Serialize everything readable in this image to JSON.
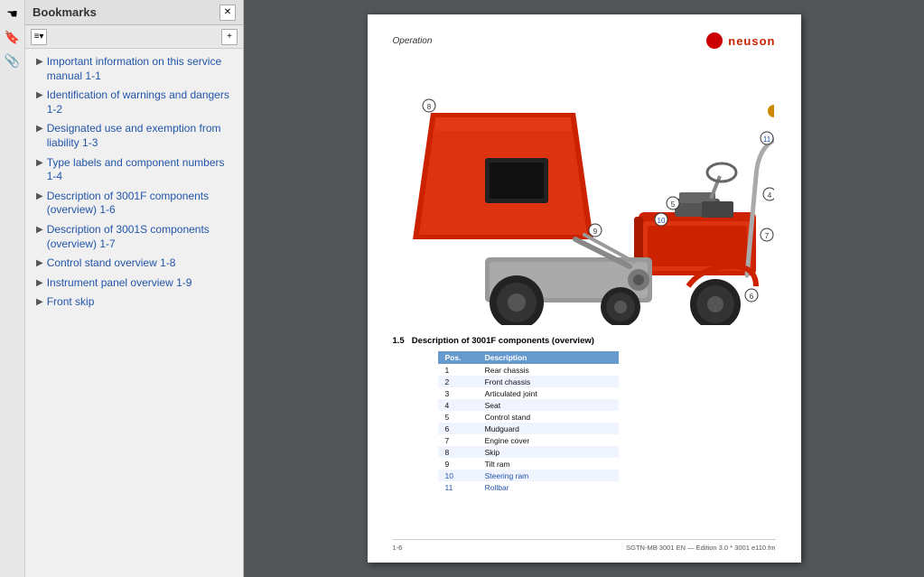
{
  "sidebar": {
    "title": "Bookmarks",
    "items": [
      {
        "label": "Important information on this service manual 1-1",
        "id": "bm-1"
      },
      {
        "label": "Identification of warnings and dangers 1-2",
        "id": "bm-2"
      },
      {
        "label": "Designated use and exemption from liability 1-3",
        "id": "bm-3"
      },
      {
        "label": "Type labels and component numbers 1-4",
        "id": "bm-4"
      },
      {
        "label": "Description of 3001F components (overview) 1-6",
        "id": "bm-5"
      },
      {
        "label": "Description of 3001S components (overview) 1-7",
        "id": "bm-6"
      },
      {
        "label": "Control stand overview 1-8",
        "id": "bm-7"
      },
      {
        "label": "Instrument panel overview 1-9",
        "id": "bm-8"
      },
      {
        "label": "Front skip",
        "id": "bm-9"
      }
    ]
  },
  "pdf": {
    "header_operation": "Operation",
    "header_brand": "neuson",
    "section_label": "1.5",
    "section_title": "Description of 3001F components (overview)",
    "table_headers": [
      "Pos.",
      "Description"
    ],
    "table_rows": [
      {
        "pos": "1",
        "desc": "Rear chassis"
      },
      {
        "pos": "2",
        "desc": "Front chassis"
      },
      {
        "pos": "3",
        "desc": "Articulated joint"
      },
      {
        "pos": "4",
        "desc": "Seat"
      },
      {
        "pos": "5",
        "desc": "Control stand"
      },
      {
        "pos": "6",
        "desc": "Mudguard"
      },
      {
        "pos": "7",
        "desc": "Engine cover"
      },
      {
        "pos": "8",
        "desc": "Skip"
      },
      {
        "pos": "9",
        "desc": "Tilt ram"
      },
      {
        "pos": "10",
        "desc": "Steering ram",
        "highlight": true
      },
      {
        "pos": "11",
        "desc": "Rollbar",
        "highlight": true
      }
    ],
    "footer_left": "1-6",
    "footer_right": "SGTN-MB 3001 EN — Edition 3.0 * 3001 e110.fm"
  }
}
